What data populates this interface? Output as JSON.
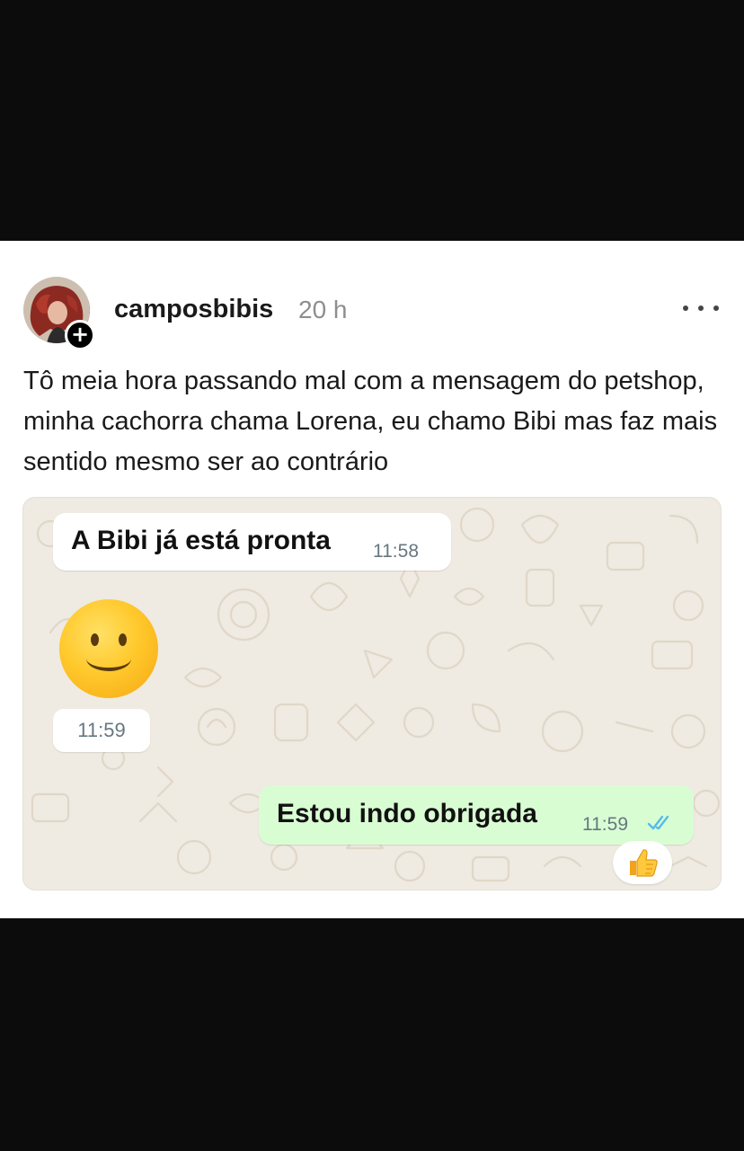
{
  "post": {
    "username": "camposbibis",
    "time": "20 h",
    "text": "Tô meia hora passando mal com a mensagem do petshop, minha cachorra chama Lorena, eu chamo Bibi mas faz mais sentido mesmo ser ao contrário",
    "follow_badge": "+",
    "more_icon": "more-horizontal-icon"
  },
  "chat": {
    "incoming": {
      "text": "A Bibi já está pronta",
      "time": "11:58"
    },
    "sticker": {
      "icon": "slightly-smiling-face-icon",
      "time": "11:59"
    },
    "outgoing": {
      "text": "Estou indo obrigada",
      "time": "11:59",
      "status_icon": "double-check-read-icon",
      "status_color": "#53bdeb"
    },
    "reaction": {
      "icon": "thumbs-up-icon"
    },
    "colors": {
      "background": "#efeae2",
      "incoming_bubble": "#ffffff",
      "outgoing_bubble": "#d9fdd3"
    }
  }
}
